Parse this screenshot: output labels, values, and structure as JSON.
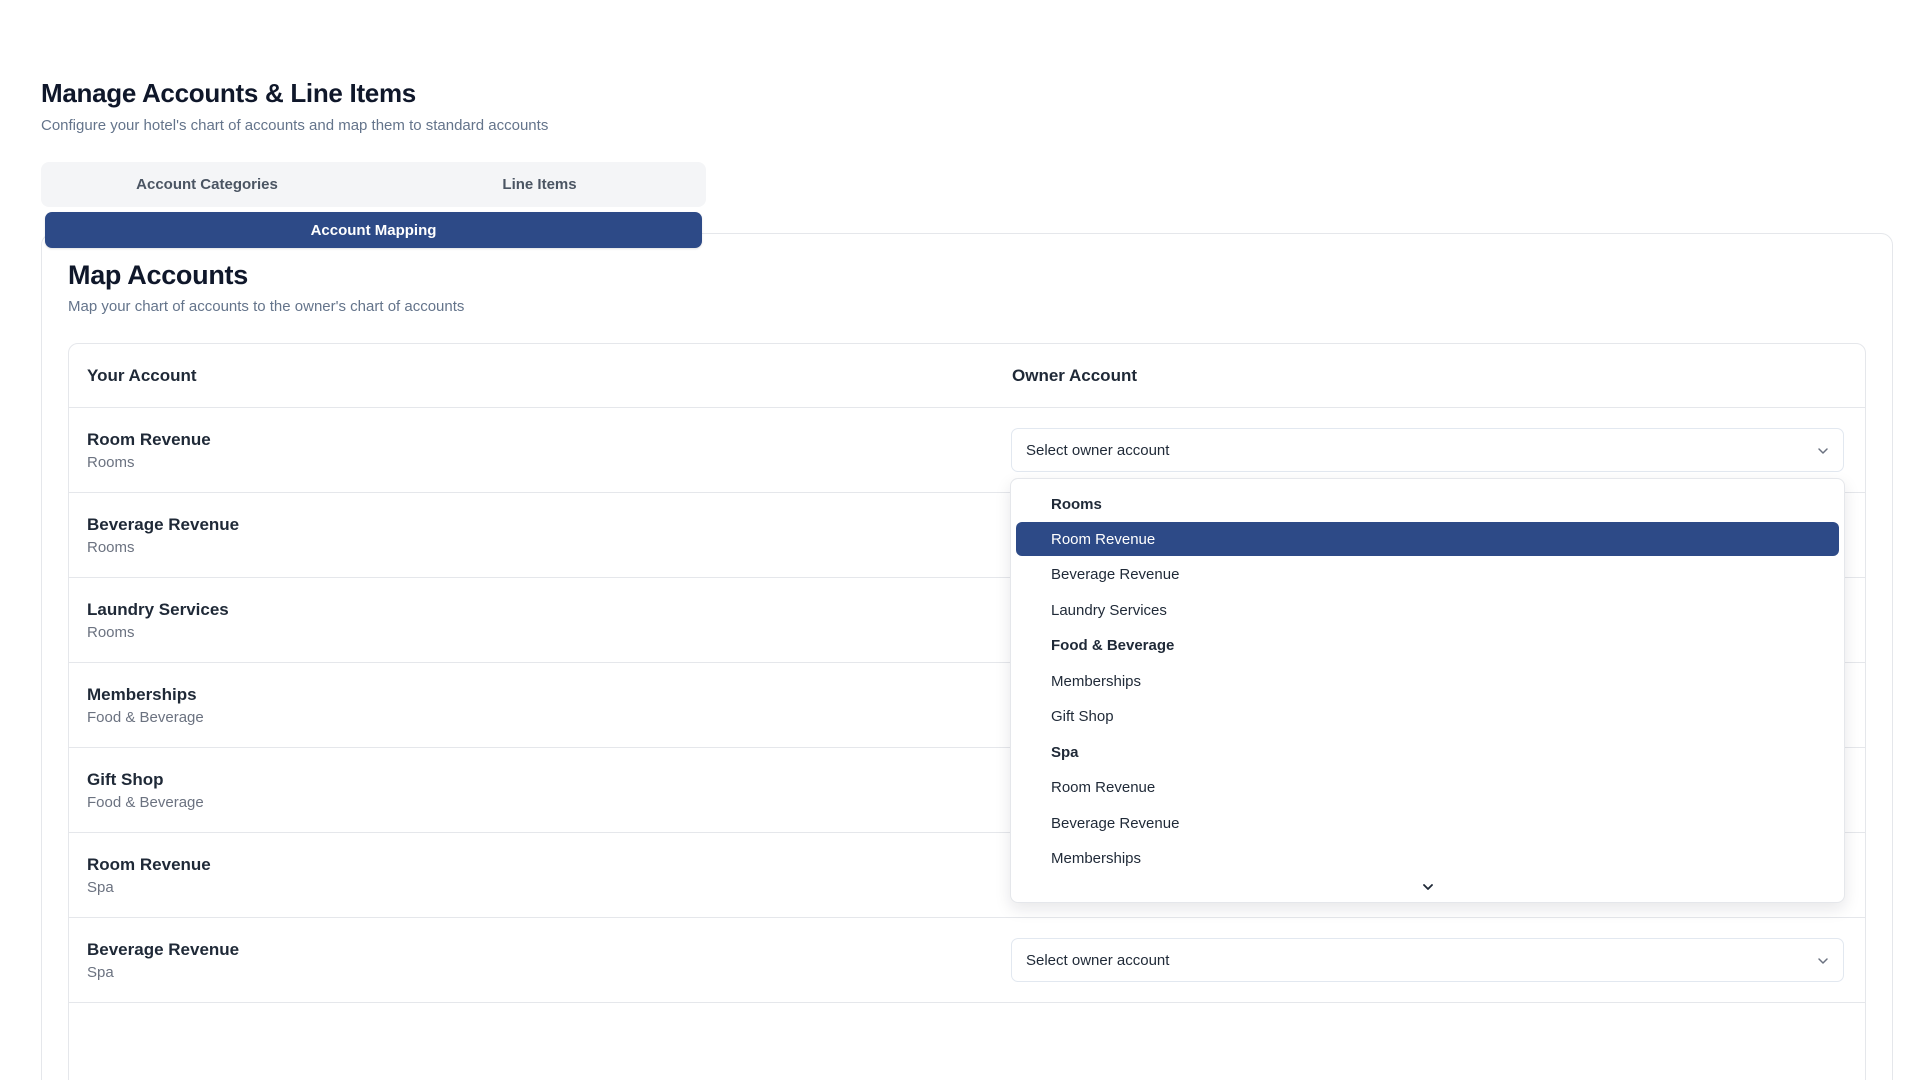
{
  "header": {
    "title": "Manage Accounts & Line Items",
    "subtitle": "Configure your hotel's chart of accounts and map them to standard accounts"
  },
  "tabs": {
    "categories": "Account Categories",
    "line_items": "Line Items",
    "mapping": "Account Mapping",
    "active": "Account Mapping"
  },
  "card": {
    "title": "Map Accounts",
    "subtitle": "Map your chart of accounts to the owner's chart of accounts"
  },
  "table": {
    "col_your": "Your Account",
    "col_owner": "Owner Account",
    "select_placeholder": "Select owner account",
    "rows": [
      {
        "name": "Room Revenue",
        "category": "Rooms"
      },
      {
        "name": "Beverage Revenue",
        "category": "Rooms"
      },
      {
        "name": "Laundry Services",
        "category": "Rooms"
      },
      {
        "name": "Memberships",
        "category": "Food & Beverage"
      },
      {
        "name": "Gift Shop",
        "category": "Food & Beverage"
      },
      {
        "name": "Room Revenue",
        "category": "Spa"
      },
      {
        "name": "Beverage Revenue",
        "category": "Spa"
      }
    ]
  },
  "dropdown": {
    "items": [
      {
        "label": "Rooms",
        "type": "group"
      },
      {
        "label": "Room Revenue",
        "type": "option",
        "selected": true
      },
      {
        "label": "Beverage Revenue",
        "type": "option"
      },
      {
        "label": "Laundry Services",
        "type": "option"
      },
      {
        "label": "Food & Beverage",
        "type": "group"
      },
      {
        "label": "Memberships",
        "type": "option"
      },
      {
        "label": "Gift Shop",
        "type": "option"
      },
      {
        "label": "Spa",
        "type": "group"
      },
      {
        "label": "Room Revenue",
        "type": "option"
      },
      {
        "label": "Beverage Revenue",
        "type": "option"
      },
      {
        "label": "Memberships",
        "type": "option"
      }
    ],
    "scroll_icon": "chevron-down-icon"
  },
  "colors": {
    "accent": "#2d4a87",
    "muted_text": "#64748b",
    "border": "#e5e7eb"
  }
}
